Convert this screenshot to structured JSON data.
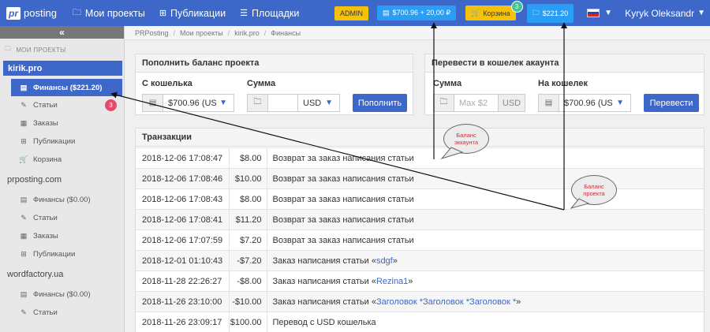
{
  "topbar": {
    "logo_mark": "pr",
    "logo_text": "posting",
    "nav": [
      "Мои проекты",
      "Публикации",
      "Площадки"
    ],
    "admin_label": "ADMIN",
    "account_balance": "$700.96 + 20,00 ₽",
    "cart_label": "Корзина",
    "cart_count": "3",
    "project_balance": "$221.20",
    "user_name": "Kyryk Oleksandr"
  },
  "sidebar": {
    "collapse": "«",
    "section_label": "МОИ ПРОЕКТЫ",
    "projects": [
      {
        "name": "kirik.pro",
        "items": [
          {
            "label": "Финансы ($221.20)",
            "icon": "wallet-icon"
          },
          {
            "label": "Статьи",
            "icon": "pencil-icon",
            "badge": "3"
          },
          {
            "label": "Заказы",
            "icon": "list-icon"
          },
          {
            "label": "Публикации",
            "icon": "sitemap-icon"
          },
          {
            "label": "Корзина",
            "icon": "cart-icon"
          }
        ]
      },
      {
        "name": "prposting.com",
        "items": [
          {
            "label": "Финансы ($0.00)",
            "icon": "wallet-icon"
          },
          {
            "label": "Статьи",
            "icon": "pencil-icon"
          },
          {
            "label": "Заказы",
            "icon": "list-icon"
          },
          {
            "label": "Публикации",
            "icon": "sitemap-icon"
          }
        ]
      },
      {
        "name": "wordfactory.ua",
        "items": [
          {
            "label": "Финансы ($0.00)",
            "icon": "wallet-icon"
          },
          {
            "label": "Статьи",
            "icon": "pencil-icon"
          }
        ]
      }
    ]
  },
  "breadcrumb": [
    "PRPosting",
    "Мои проекты",
    "kirik.pro",
    "Финансы"
  ],
  "topup": {
    "title": "Пополнить баланс проекта",
    "from_label": "С кошелька",
    "from_value": "$700.96 (US",
    "amount_label": "Сумма",
    "amount_value": "",
    "currency": "USD",
    "submit": "Пополнить"
  },
  "transfer": {
    "title": "Перевести в кошелек акаунта",
    "amount_label": "Сумма",
    "amount_placeholder": "Max $2",
    "currency": "USD",
    "to_label": "На кошелек",
    "to_value": "$700.96 (US",
    "submit": "Перевести"
  },
  "transactions": {
    "title": "Транзакции",
    "rows": [
      {
        "date": "2018-12-06 17:08:47",
        "amount": "$8.00",
        "desc": "Возврат за заказ написания статьи",
        "link": "",
        "suffix": ""
      },
      {
        "date": "2018-12-06 17:08:46",
        "amount": "$10.00",
        "desc": "Возврат за заказ написания статьи",
        "link": "",
        "suffix": ""
      },
      {
        "date": "2018-12-06 17:08:43",
        "amount": "$8.00",
        "desc": "Возврат за заказ написания статьи",
        "link": "",
        "suffix": ""
      },
      {
        "date": "2018-12-06 17:08:41",
        "amount": "$11.20",
        "desc": "Возврат за заказ написания статьи",
        "link": "",
        "suffix": ""
      },
      {
        "date": "2018-12-06 17:07:59",
        "amount": "$7.20",
        "desc": "Возврат за заказ написания статьи",
        "link": "",
        "suffix": ""
      },
      {
        "date": "2018-12-01 01:10:43",
        "amount": "-$7.20",
        "desc": "Заказ написания статьи «",
        "link": "sdgf",
        "suffix": "»"
      },
      {
        "date": "2018-11-28 22:26:27",
        "amount": "-$8.00",
        "desc": "Заказ написания статьи «",
        "link": "Rezina1",
        "suffix": "»"
      },
      {
        "date": "2018-11-26 23:10:00",
        "amount": "-$10.00",
        "desc": "Заказ написания статьи «",
        "link": "Заголовок *Заголовок *Заголовок *",
        "suffix": "»"
      },
      {
        "date": "2018-11-26 23:09:17",
        "amount": "$100.00",
        "desc": "Перевод с USD кошелька",
        "link": "",
        "suffix": ""
      }
    ]
  },
  "annotations": {
    "account": [
      "Баланс",
      "эккаунта"
    ],
    "project": [
      "Баланс",
      "проекта"
    ]
  },
  "colors": {
    "primary": "#3d67c9",
    "accent_blue": "#2a9df4",
    "yellow": "#f4c20d",
    "badge_red": "#e84a6b",
    "badge_green": "#3ec792"
  }
}
